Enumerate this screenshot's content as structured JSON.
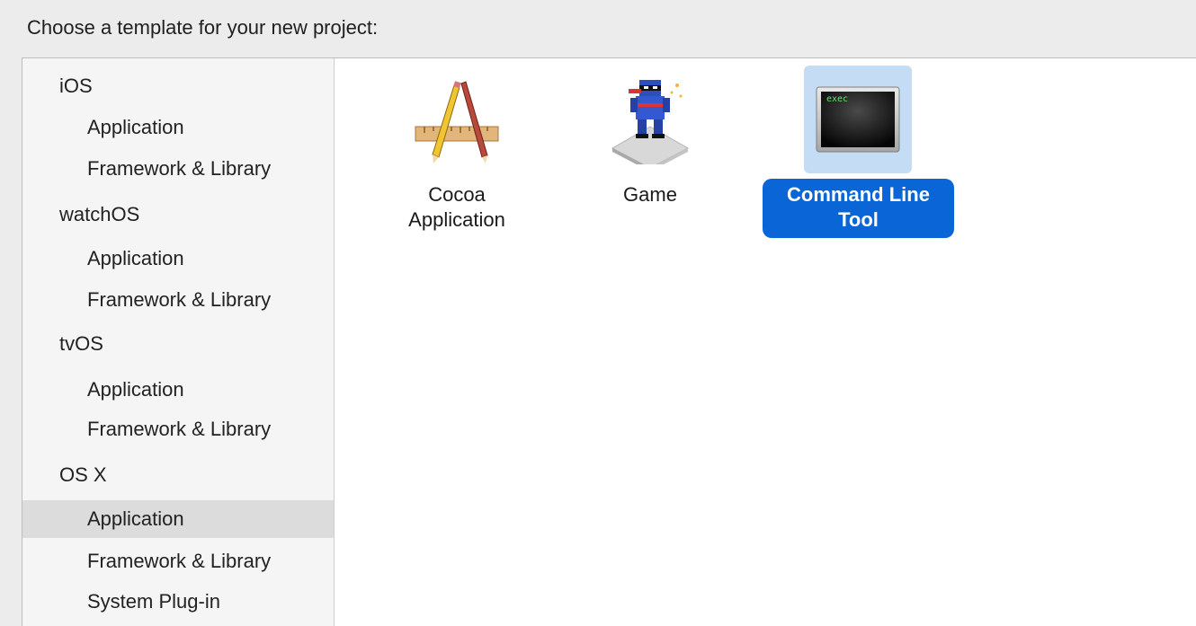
{
  "header": {
    "prompt": "Choose a template for your new project:"
  },
  "sidebar": {
    "groups": [
      {
        "platform": "iOS",
        "items": [
          "Application",
          "Framework & Library"
        ]
      },
      {
        "platform": "watchOS",
        "items": [
          "Application",
          "Framework & Library"
        ]
      },
      {
        "platform": "tvOS",
        "items": [
          "Application",
          "Framework & Library"
        ]
      },
      {
        "platform": "OS X",
        "items": [
          "Application",
          "Framework & Library",
          "System Plug-in"
        ]
      }
    ],
    "selected": "OS X / Application"
  },
  "templates": [
    {
      "label": "Cocoa\nApplication",
      "icon": "cocoa-application-icon",
      "selected": false
    },
    {
      "label": "Game",
      "icon": "game-icon",
      "selected": false
    },
    {
      "label": "Command Line\nTool",
      "icon": "terminal-exec-icon",
      "icon_text": "exec",
      "selected": true
    }
  ],
  "colors": {
    "selection_blue": "#0a66d6",
    "icon_highlight": "#c5dcf5",
    "sidebar_selected": "#dcdcdc"
  }
}
